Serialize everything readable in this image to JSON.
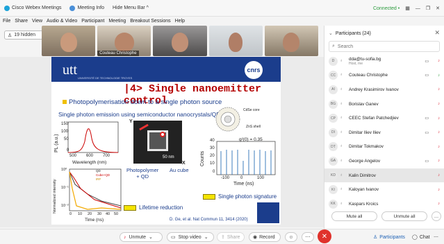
{
  "titlebar": {
    "app": "Cisco Webex Meetings",
    "meeting_info": "Meeting Info",
    "hide_menu": "Hide Menu Bar ^",
    "connected": "Connected •",
    "status_dot": "•"
  },
  "menubar": [
    "File",
    "Share",
    "View",
    "Audio & Video",
    "Participant",
    "Meeting",
    "Breakout Sessions",
    "Help"
  ],
  "hidden_count": "19 hidden",
  "thumbnails": [
    {
      "name": ""
    },
    {
      "name": "Couteau Christophe"
    },
    {
      "name": ""
    },
    {
      "name": ""
    },
    {
      "name": ""
    }
  ],
  "slide": {
    "logo": "utt",
    "logo_sub": "UNIVERSITÉ DE TECHNOLOGIE TROYES",
    "cnrs": "cnrs",
    "title": "|4> Single nanoemitter control",
    "bullet": "Photopolymerisation down to a single photon source",
    "subtitle": "Single photon emission using semiconductor nanocrystals/QDs",
    "pl_ylabel": "PL (a.u.)",
    "pl_xlabel": "Wavelength (nm)",
    "pl_ticks_x": [
      "500",
      "600",
      "700"
    ],
    "pl_ticks_y": [
      "150",
      "100",
      "50",
      "0"
    ],
    "y_label": "Y",
    "x_label": "X",
    "cdse_core": "CdSe core",
    "zns_shell": "ZnS shell",
    "scale_bar": "50 nm",
    "photopolymer": "Photopolymer\n+ QD",
    "au_cube": "Au cube",
    "g2": "g²(0) = 0.35",
    "counts_ylabel": "Counts",
    "counts_ticks_y": [
      "40",
      "30",
      "20",
      "10",
      "0"
    ],
    "counts_xlabel": "Time (ns)",
    "counts_ticks_x": [
      "-100",
      "0",
      "100"
    ],
    "decay_ylabel": "Normalized intensity",
    "decay_xlabel": "Time (ns)",
    "decay_ticks_x": [
      "0",
      "10",
      "20",
      "30",
      "40",
      "50"
    ],
    "decay_ticks_y": [
      "10⁰",
      "10⁻¹",
      "10⁻²"
    ],
    "decay_legend": [
      "QD",
      "Cube+QD",
      "IRF"
    ],
    "lifetime": "Lifetime reduction",
    "signature": "Single photon signature",
    "citation": "D. Ge, et al. Nat Commun 11, 3414 (2020)"
  },
  "participants": {
    "header": "Participants (24)",
    "search_placeholder": "Search",
    "list": [
      {
        "initials": "D",
        "name": "dda@tu-sofia.bg",
        "sub": "Host, me"
      },
      {
        "initials": "CC",
        "name": "Couteau Christophe",
        "sub": ""
      },
      {
        "initials": "AI",
        "name": "Andrey Krasimirov Ivanov",
        "sub": ""
      },
      {
        "initials": "BG",
        "name": "Borislav Ganev",
        "sub": ""
      },
      {
        "initials": "CP",
        "name": "CEEC Stefan Patchedjiev",
        "sub": ""
      },
      {
        "initials": "DI",
        "name": "Dimitar Iliev Iliev",
        "sub": ""
      },
      {
        "initials": "DT",
        "name": "Dimitar Tokmakov",
        "sub": ""
      },
      {
        "initials": "GA",
        "name": "George Angelov",
        "sub": ""
      },
      {
        "initials": "KD",
        "name": "Kalin Dimitrov",
        "sub": ""
      },
      {
        "initials": "KI",
        "name": "Kaloyan Ivanov",
        "sub": ""
      },
      {
        "initials": "KK",
        "name": "Kaspars Kroics",
        "sub": ""
      }
    ],
    "mute_all": "Mute all",
    "unmute_all": "Unmute all"
  },
  "controls": {
    "unmute": "Unmute",
    "stop_video": "Stop video",
    "share": "Share",
    "record": "Record",
    "participants": "Participants",
    "chat": "Chat"
  },
  "colors": {
    "accent": "#1b3d8c",
    "danger": "#e0322c",
    "title_red": "#b40000"
  }
}
